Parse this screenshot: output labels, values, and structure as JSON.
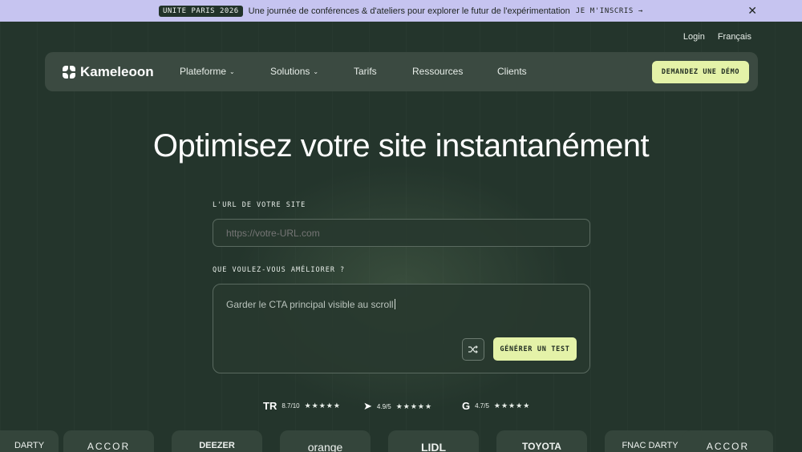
{
  "announcement": {
    "tag": "UNITE PARIS 2026",
    "text": "Une journée de conférences & d'ateliers pour explorer le futur de l'expérimentation",
    "cta": "JE M'INSCRIS",
    "close": "✕"
  },
  "toplinks": {
    "login": "Login",
    "language": "Français"
  },
  "nav": {
    "brand": "Kameleoon",
    "items": [
      {
        "label": "Plateforme"
      },
      {
        "label": "Solutions"
      },
      {
        "label": "Tarifs"
      },
      {
        "label": "Ressources"
      },
      {
        "label": "Clients"
      }
    ],
    "demo_label": "DEMANDEZ UNE DÉMO"
  },
  "hero": {
    "title": "Optimisez votre site instantanément",
    "url_label": "L'URL DE VOTRE SITE",
    "url_placeholder": "https://votre-URL.com",
    "improve_label": "QUE VOULEZ-VOUS AMÉLIORER ?",
    "improve_value": "Garder le CTA principal visible au scroll",
    "generate_label": "GÉNÉRER UN TEST"
  },
  "ratings": [
    {
      "icon": "TR",
      "score": "8.7/10",
      "stars": "★★★★★"
    },
    {
      "icon": "➤",
      "score": "4.9/5",
      "stars": "★★★★★"
    },
    {
      "icon": "G",
      "score": "4.7/5",
      "stars": "★★★★★"
    }
  ],
  "logos": [
    "DARTY",
    "ACCOR",
    "DEEZER",
    "orange",
    "LIDL",
    "TOYOTA",
    "FNAC DARTY",
    "ACCOR"
  ],
  "colors": {
    "accent": "#e4f2a8",
    "banner": "#c6c4f0",
    "background": "#24352c"
  }
}
